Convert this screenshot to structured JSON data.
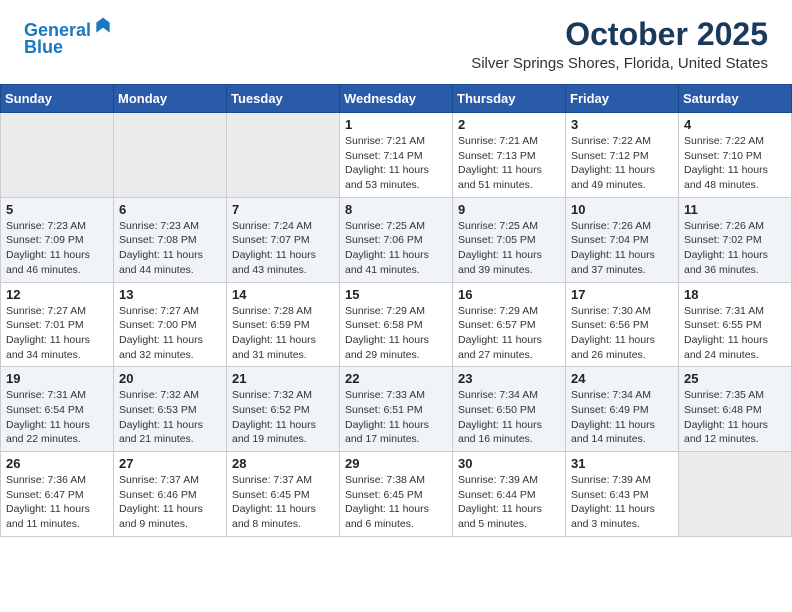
{
  "header": {
    "logo_line1": "General",
    "logo_line2": "Blue",
    "month": "October 2025",
    "location": "Silver Springs Shores, Florida, United States"
  },
  "days_of_week": [
    "Sunday",
    "Monday",
    "Tuesday",
    "Wednesday",
    "Thursday",
    "Friday",
    "Saturday"
  ],
  "weeks": [
    [
      {
        "day": "",
        "info": ""
      },
      {
        "day": "",
        "info": ""
      },
      {
        "day": "",
        "info": ""
      },
      {
        "day": "1",
        "info": "Sunrise: 7:21 AM\nSunset: 7:14 PM\nDaylight: 11 hours and 53 minutes."
      },
      {
        "day": "2",
        "info": "Sunrise: 7:21 AM\nSunset: 7:13 PM\nDaylight: 11 hours and 51 minutes."
      },
      {
        "day": "3",
        "info": "Sunrise: 7:22 AM\nSunset: 7:12 PM\nDaylight: 11 hours and 49 minutes."
      },
      {
        "day": "4",
        "info": "Sunrise: 7:22 AM\nSunset: 7:10 PM\nDaylight: 11 hours and 48 minutes."
      }
    ],
    [
      {
        "day": "5",
        "info": "Sunrise: 7:23 AM\nSunset: 7:09 PM\nDaylight: 11 hours and 46 minutes."
      },
      {
        "day": "6",
        "info": "Sunrise: 7:23 AM\nSunset: 7:08 PM\nDaylight: 11 hours and 44 minutes."
      },
      {
        "day": "7",
        "info": "Sunrise: 7:24 AM\nSunset: 7:07 PM\nDaylight: 11 hours and 43 minutes."
      },
      {
        "day": "8",
        "info": "Sunrise: 7:25 AM\nSunset: 7:06 PM\nDaylight: 11 hours and 41 minutes."
      },
      {
        "day": "9",
        "info": "Sunrise: 7:25 AM\nSunset: 7:05 PM\nDaylight: 11 hours and 39 minutes."
      },
      {
        "day": "10",
        "info": "Sunrise: 7:26 AM\nSunset: 7:04 PM\nDaylight: 11 hours and 37 minutes."
      },
      {
        "day": "11",
        "info": "Sunrise: 7:26 AM\nSunset: 7:02 PM\nDaylight: 11 hours and 36 minutes."
      }
    ],
    [
      {
        "day": "12",
        "info": "Sunrise: 7:27 AM\nSunset: 7:01 PM\nDaylight: 11 hours and 34 minutes."
      },
      {
        "day": "13",
        "info": "Sunrise: 7:27 AM\nSunset: 7:00 PM\nDaylight: 11 hours and 32 minutes."
      },
      {
        "day": "14",
        "info": "Sunrise: 7:28 AM\nSunset: 6:59 PM\nDaylight: 11 hours and 31 minutes."
      },
      {
        "day": "15",
        "info": "Sunrise: 7:29 AM\nSunset: 6:58 PM\nDaylight: 11 hours and 29 minutes."
      },
      {
        "day": "16",
        "info": "Sunrise: 7:29 AM\nSunset: 6:57 PM\nDaylight: 11 hours and 27 minutes."
      },
      {
        "day": "17",
        "info": "Sunrise: 7:30 AM\nSunset: 6:56 PM\nDaylight: 11 hours and 26 minutes."
      },
      {
        "day": "18",
        "info": "Sunrise: 7:31 AM\nSunset: 6:55 PM\nDaylight: 11 hours and 24 minutes."
      }
    ],
    [
      {
        "day": "19",
        "info": "Sunrise: 7:31 AM\nSunset: 6:54 PM\nDaylight: 11 hours and 22 minutes."
      },
      {
        "day": "20",
        "info": "Sunrise: 7:32 AM\nSunset: 6:53 PM\nDaylight: 11 hours and 21 minutes."
      },
      {
        "day": "21",
        "info": "Sunrise: 7:32 AM\nSunset: 6:52 PM\nDaylight: 11 hours and 19 minutes."
      },
      {
        "day": "22",
        "info": "Sunrise: 7:33 AM\nSunset: 6:51 PM\nDaylight: 11 hours and 17 minutes."
      },
      {
        "day": "23",
        "info": "Sunrise: 7:34 AM\nSunset: 6:50 PM\nDaylight: 11 hours and 16 minutes."
      },
      {
        "day": "24",
        "info": "Sunrise: 7:34 AM\nSunset: 6:49 PM\nDaylight: 11 hours and 14 minutes."
      },
      {
        "day": "25",
        "info": "Sunrise: 7:35 AM\nSunset: 6:48 PM\nDaylight: 11 hours and 12 minutes."
      }
    ],
    [
      {
        "day": "26",
        "info": "Sunrise: 7:36 AM\nSunset: 6:47 PM\nDaylight: 11 hours and 11 minutes."
      },
      {
        "day": "27",
        "info": "Sunrise: 7:37 AM\nSunset: 6:46 PM\nDaylight: 11 hours and 9 minutes."
      },
      {
        "day": "28",
        "info": "Sunrise: 7:37 AM\nSunset: 6:45 PM\nDaylight: 11 hours and 8 minutes."
      },
      {
        "day": "29",
        "info": "Sunrise: 7:38 AM\nSunset: 6:45 PM\nDaylight: 11 hours and 6 minutes."
      },
      {
        "day": "30",
        "info": "Sunrise: 7:39 AM\nSunset: 6:44 PM\nDaylight: 11 hours and 5 minutes."
      },
      {
        "day": "31",
        "info": "Sunrise: 7:39 AM\nSunset: 6:43 PM\nDaylight: 11 hours and 3 minutes."
      },
      {
        "day": "",
        "info": ""
      }
    ]
  ]
}
